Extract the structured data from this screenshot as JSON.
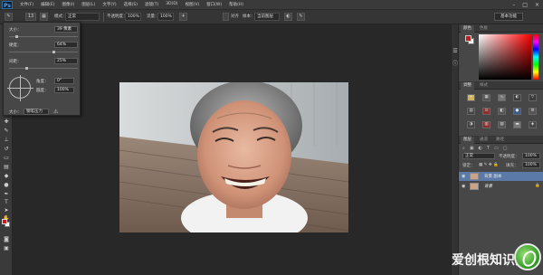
{
  "menubar": {
    "logo": "Ps",
    "items": [
      "文件(F)",
      "编辑(E)",
      "图像(I)",
      "图层(L)",
      "文字(Y)",
      "选择(S)",
      "滤镜(T)",
      "3D(D)",
      "视图(V)",
      "窗口(W)",
      "帮助(H)"
    ],
    "window_buttons": [
      "–",
      "□",
      "×"
    ]
  },
  "options": {
    "brush_size": "13",
    "mode_label": "模式：",
    "mode_value": "正常",
    "opacity_label": "不透明度：",
    "opacity_value": "100%",
    "flow_label": "流量：",
    "flow_value": "100%",
    "sample_label": "对齐",
    "sample_mode_label": "样本：",
    "sample_mode_value": "当前图层",
    "workspace": "基本功能"
  },
  "brush_panel": {
    "size_label": "大小：",
    "size_value": "39 像素",
    "hardness_label": "硬度：",
    "hardness_value": "64%",
    "spacing_label": "间距：",
    "spacing_value": "25%",
    "angle_label": "角度：",
    "angle_value": "0°",
    "roundness_label": "圆度：",
    "roundness_value": "100%",
    "size_mode_label": "大小：",
    "size_mode_value": "钢笔压力"
  },
  "right_panel": {
    "tab_color": "颜色",
    "tab_swatches": "色板",
    "tab_adjust": "调整",
    "tab_styles": "样式",
    "tab_layers": "图层",
    "tab_channels": "通道",
    "tab_paths": "路径",
    "blend_mode": "正常",
    "opacity_label": "不透明度：",
    "opacity_value": "100%",
    "lock_label": "锁定：",
    "fill_label": "填充：",
    "fill_value": "100%",
    "layers": [
      {
        "name": "背景 副本",
        "selected": true
      },
      {
        "name": "背景",
        "selected": false
      }
    ]
  },
  "colors": {
    "foreground": "#d01818",
    "background": "#ffffff",
    "selected_layer": "#5b7aa7"
  },
  "watermark": {
    "text": "爱创根知识网"
  }
}
